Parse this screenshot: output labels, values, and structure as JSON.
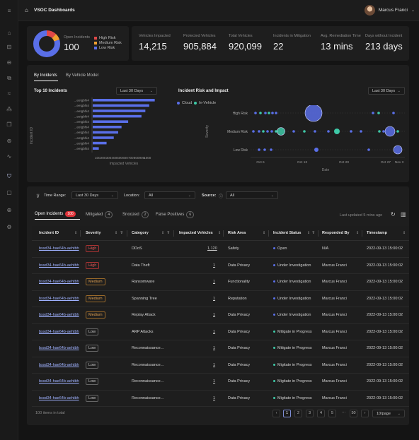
{
  "app": {
    "title": "VSOC Dashboards",
    "user": "Marcus Franci"
  },
  "summary": {
    "open_incidents_label": "Open Incidents",
    "open_incidents": "100",
    "legend": [
      {
        "label": "High Risk",
        "color": "#e04848"
      },
      {
        "label": "Medium Risk",
        "color": "#f0a030"
      },
      {
        "label": "Low Risk",
        "color": "#5a6fe8"
      }
    ],
    "donut": [
      {
        "value": 0.12,
        "color": "#e04848"
      },
      {
        "value": 0.08,
        "color": "#f0a030"
      },
      {
        "value": 0.8,
        "color": "#5a6fe8"
      }
    ],
    "stats": [
      {
        "label": "Vehicles Impacted",
        "value": "14,215"
      },
      {
        "label": "Protected Vehicles",
        "value": "905,884"
      },
      {
        "label": "Total Vehicles",
        "value": "920,099"
      },
      {
        "label": "Incidents in Mitigation",
        "value": "22"
      },
      {
        "label": "Avg. Remediation Time",
        "value": "13 mins"
      },
      {
        "label": "Days without Incident",
        "value": "213 days"
      }
    ]
  },
  "view_tabs": [
    "By Incidents",
    "By Vehicle Model"
  ],
  "top10": {
    "title": "Top 10 Incidents",
    "range": "Last 30 Days",
    "ylabel": "Incident ID",
    "xlabel": "Impacted Vehicles",
    "categories": [
      "...eetgbhi4",
      "...eetgbhi4",
      "...eetgbhi4",
      "...eetgbhi4",
      "...eetgbhi4",
      "...eetgbhi4",
      "...eetgbhi4",
      "...eetgbhi4",
      "...eetgbhi4",
      "...eetgbhi4"
    ],
    "values": [
      1120,
      1020,
      950,
      880,
      640,
      520,
      460,
      380,
      250,
      110
    ],
    "ticks": [
      "100",
      "200",
      "300",
      "400",
      "500",
      "600",
      "700",
      "800",
      "900",
      "1000"
    ],
    "xlim": [
      0,
      1150
    ]
  },
  "risk": {
    "title": "Incident Risk and Impact",
    "range": "Last 30 Days",
    "ylabel": "Severity",
    "xlabel": "Date",
    "legend": [
      {
        "label": "Cloud",
        "color": "#5a6fe8"
      },
      {
        "label": "In-Vehicle",
        "color": "#3ec9a7"
      }
    ],
    "levels": [
      "High Risk",
      "Medium Risk",
      "Low Risk"
    ],
    "xticks": [
      "Oct 6",
      "Oct 13",
      "Oct 20",
      "Oct 27",
      "Nov 3"
    ]
  },
  "filters": {
    "time_label": "Time Range:",
    "time_value": "Last 30 Days",
    "location_label": "Location:",
    "location_value": "All",
    "source_label": "Source:",
    "source_value": "All"
  },
  "incident_tabs": [
    {
      "label": "Open Incidents",
      "count": "100"
    },
    {
      "label": "Mitigated",
      "count": "4"
    },
    {
      "label": "Snoozed",
      "count": "2"
    },
    {
      "label": "False Positives",
      "count": "6"
    }
  ],
  "last_updated": "Last updated 5 mins ago",
  "columns": [
    "Incident ID",
    "Severity",
    "Category",
    "Impacted Vehicles",
    "Risk Area",
    "Incident Status",
    "Responded By",
    "Timestamp"
  ],
  "rows": [
    {
      "id": "bssd34-hae64b-aehtbh",
      "sev": "High",
      "cat": "DDoS",
      "veh": "1,120",
      "area": "Safety",
      "status": "Open",
      "by": "N/A",
      "ts": "2022-09-13 15:00:02"
    },
    {
      "id": "bssd34-hae64b-aehtbh",
      "sev": "High",
      "cat": "Data Theft",
      "veh": "1",
      "area": "Data Privacy",
      "status": "Under Investigation",
      "by": "Marcus Franci",
      "ts": "2022-09-13 15:00:02"
    },
    {
      "id": "bssd34-hae64b-aehtbh",
      "sev": "Medium",
      "cat": "Ransomware",
      "veh": "1",
      "area": "Functionality",
      "status": "Under Investigation",
      "by": "Marcus Franci",
      "ts": "2022-09-13 15:00:02"
    },
    {
      "id": "bssd34-hae64b-aehtbh",
      "sev": "Medium",
      "cat": "Spanning Tree",
      "veh": "1",
      "area": "Reputation",
      "status": "Under Investigation",
      "by": "Marcus Franci",
      "ts": "2022-09-13 15:00:02"
    },
    {
      "id": "bssd34-hae64b-aehtbh",
      "sev": "Medium",
      "cat": "Replay Attack",
      "veh": "1",
      "area": "Data Privacy",
      "status": "Under Investigation",
      "by": "Marcus Franci",
      "ts": "2022-09-13 15:00:02"
    },
    {
      "id": "bssd34-hae64b-aehtbh",
      "sev": "Low",
      "cat": "ARP Attacks",
      "veh": "1",
      "area": "Data Privacy",
      "status": "Mitigate in Progress",
      "by": "Marcus Franci",
      "ts": "2022-09-13 15:00:02"
    },
    {
      "id": "bssd34-hae64b-aehtbh",
      "sev": "Low",
      "cat": "Reconnaissance...",
      "veh": "1",
      "area": "Data Privacy",
      "status": "Mitigate in Progress",
      "by": "Marcus Franci",
      "ts": "2022-09-13 15:00:02"
    },
    {
      "id": "bssd34-hae64b-aehtbh",
      "sev": "Low",
      "cat": "Reconnaissance...",
      "veh": "1",
      "area": "Data Privacy",
      "status": "Migitate in Progress",
      "by": "Marcus Franci",
      "ts": "2022-09-13 15:00:02"
    },
    {
      "id": "bssd34-hae64b-aehtbh",
      "sev": "Low",
      "cat": "Reconnaissance...",
      "veh": "1",
      "area": "Data Privacy",
      "status": "Migitate in Progress",
      "by": "Marcus Franci",
      "ts": "2022-09-13 15:00:02"
    },
    {
      "id": "bssd34-hae64b-aehtbh",
      "sev": "Low",
      "cat": "Reconnaissance...",
      "veh": "1",
      "area": "Data Privacy",
      "status": "Migitate in Progress",
      "by": "Marcus Franci",
      "ts": "2022-09-13 15:00:02"
    }
  ],
  "footer": {
    "total": "100 items in total",
    "pages": [
      "1",
      "2",
      "3",
      "4",
      "5",
      "···",
      "50"
    ],
    "page_size": "10/page"
  }
}
